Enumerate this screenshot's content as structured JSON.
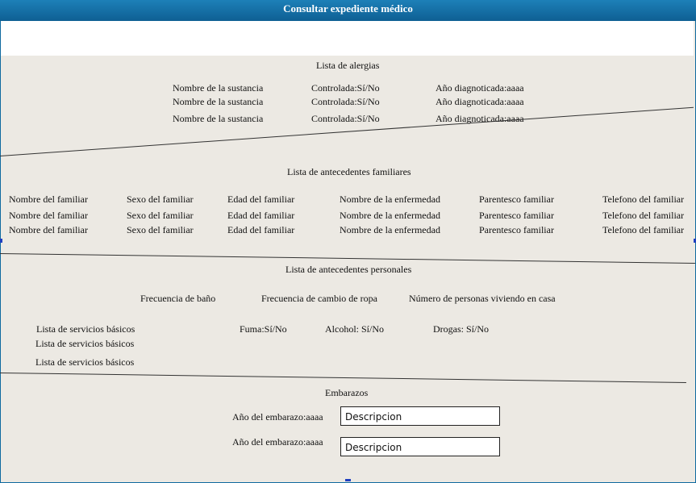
{
  "window": {
    "title": "Consultar expediente médico"
  },
  "allergies": {
    "title": "Lista de alergias",
    "rows": [
      {
        "substance": "Nombre de la sustancia",
        "controlled": "Controlada:Sí/No",
        "year": "Año diagnoticada:aaaa"
      },
      {
        "substance": "Nombre de la sustancia",
        "controlled": "Controlada:Sí/No",
        "year": "Año diagnoticada:aaaa"
      },
      {
        "substance": "Nombre de la sustancia",
        "controlled": "Controlada:Sí/No",
        "year": "Año diagnoticada:aaaa"
      }
    ]
  },
  "family": {
    "title": "Lista de antecedentes familiares",
    "rows": [
      {
        "name": "Nombre del familiar",
        "sex": "Sexo del familiar",
        "age": "Edad del familiar",
        "disease": "Nombre de la enfermedad",
        "relation": "Parentesco familiar",
        "phone": "Telefono del familiar"
      },
      {
        "name": "Nombre del familiar",
        "sex": "Sexo del familiar",
        "age": "Edad del familiar",
        "disease": "Nombre de la enfermedad",
        "relation": "Parentesco familiar",
        "phone": "Telefono del familiar"
      },
      {
        "name": "Nombre del familiar",
        "sex": "Sexo del familiar",
        "age": "Edad del familiar",
        "disease": "Nombre de la enfermedad",
        "relation": "Parentesco familiar",
        "phone": "Telefono del familiar"
      }
    ]
  },
  "personal": {
    "title": "Lista de antecedentes personales",
    "bath": "Frecuencia de baño",
    "clothes": "Frecuencia de cambio de ropa",
    "people": "Número de personas viviendo en casa",
    "services": [
      "Lista de servicios básicos",
      "Lista de servicios básicos",
      "Lista de servicios básicos"
    ],
    "smoke": "Fuma:Sí/No",
    "alcohol": "Alcohol: Sí/No",
    "drugs": "Drogas: Sí/No"
  },
  "pregnancies": {
    "title": "Embarazos",
    "rows": [
      {
        "year": "Año del embarazo:aaaa",
        "description": "Descripcion"
      },
      {
        "year": "Año del embarazo:aaaa",
        "description": "Descripcion"
      }
    ]
  }
}
